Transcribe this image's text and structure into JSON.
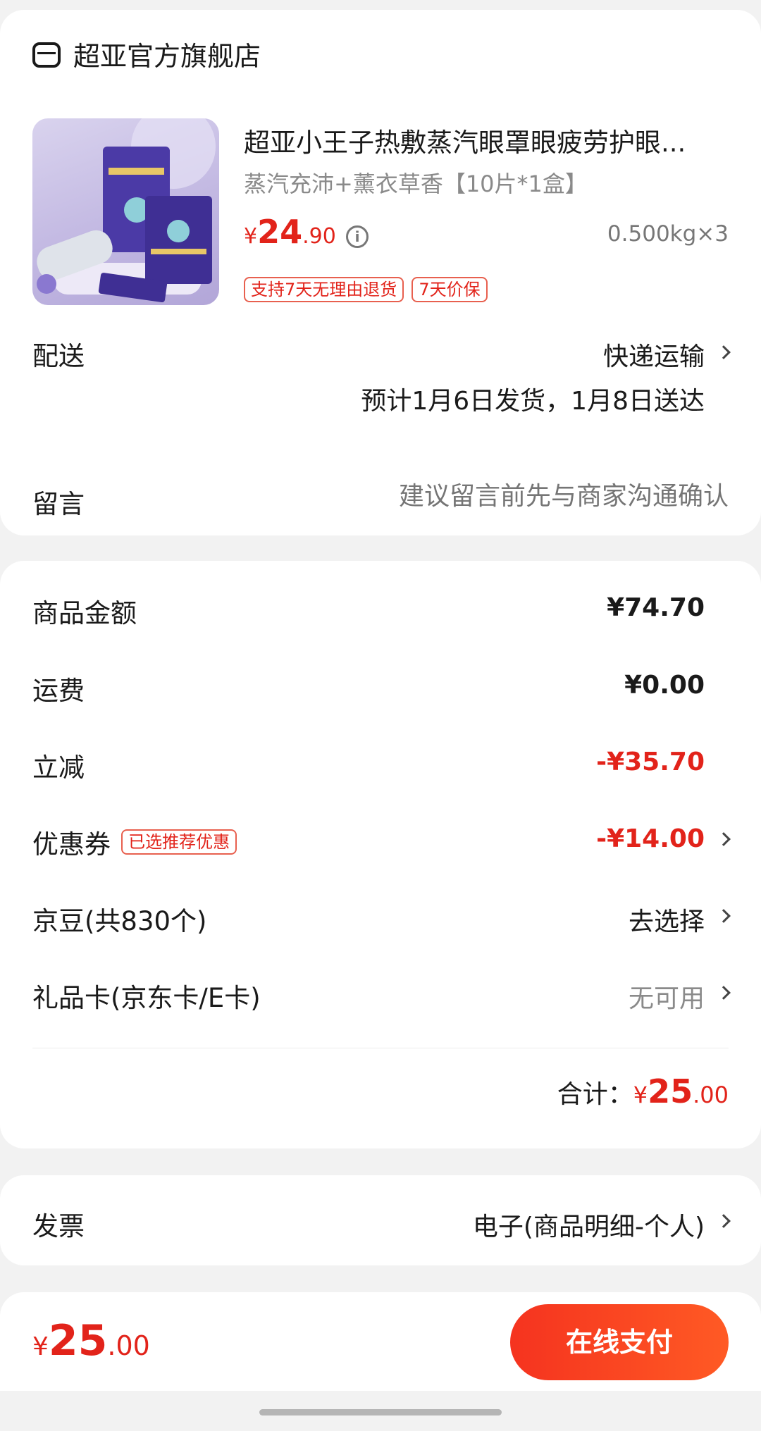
{
  "store": {
    "name": "超亚官方旗舰店",
    "icon": "store-icon"
  },
  "product": {
    "title": "超亚小王子热敷蒸汽眼罩眼疲劳护眼...",
    "spec": "蒸汽充沛+薰衣草香【10片*1盒】",
    "price_symbol": "¥",
    "price_int": "24",
    "price_dec": ".90",
    "weight_qty": "0.500kg×3",
    "tags": [
      "支持7天无理由退货",
      "7天价保"
    ]
  },
  "delivery": {
    "label": "配送",
    "method": "快递运输",
    "estimate": "预计1月6日发货，1月8日送达"
  },
  "message": {
    "label": "留言",
    "placeholder": "建议留言前先与商家沟通确认"
  },
  "summary": {
    "goods_label": "商品金额",
    "goods_value": "¥74.70",
    "shipping_label": "运费",
    "shipping_value": "¥0.00",
    "discount_label": "立减",
    "discount_value": "-¥35.70",
    "coupon_label": "优惠券",
    "coupon_tag": "已选推荐优惠",
    "coupon_value": "-¥14.00",
    "jd_bean_label": "京豆(共830个)",
    "jd_bean_value": "去选择",
    "gift_card_label": "礼品卡(京东卡/E卡)",
    "gift_card_value": "无可用",
    "total_label": "合计：",
    "total_symbol": "¥",
    "total_int": "25",
    "total_dec": ".00"
  },
  "invoice": {
    "label": "发票",
    "value": "电子(商品明细-个人)"
  },
  "footer": {
    "symbol": "¥",
    "amount_int": "25",
    "amount_dec": ".00",
    "pay_label": "在线支付"
  },
  "colors": {
    "accent_red": "#e2231a",
    "pay_gradient_start": "#f5331f",
    "pay_gradient_end": "#ff5a24"
  }
}
